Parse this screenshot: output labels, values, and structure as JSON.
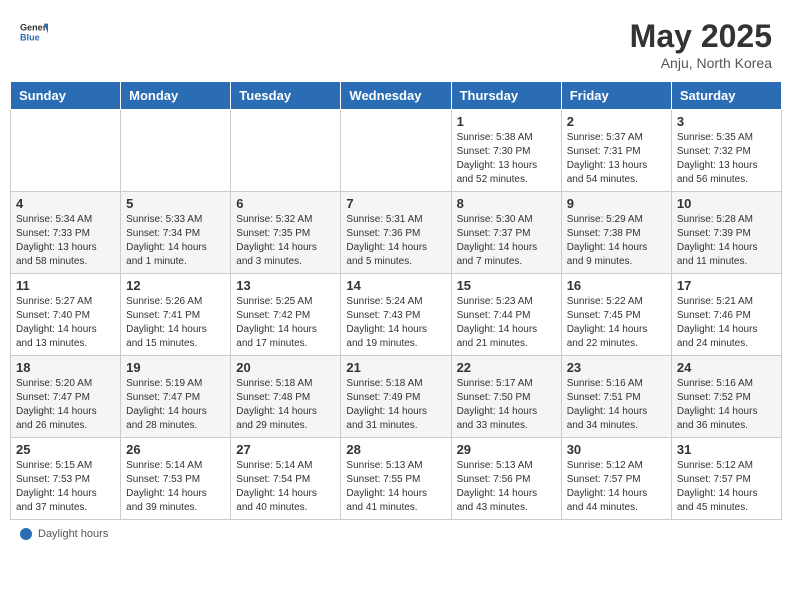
{
  "header": {
    "logo_general": "General",
    "logo_blue": "Blue",
    "month_title": "May 2025",
    "subtitle": "Anju, North Korea"
  },
  "footer": {
    "label": "Daylight hours"
  },
  "columns": [
    "Sunday",
    "Monday",
    "Tuesday",
    "Wednesday",
    "Thursday",
    "Friday",
    "Saturday"
  ],
  "weeks": [
    [
      {
        "day": "",
        "info": ""
      },
      {
        "day": "",
        "info": ""
      },
      {
        "day": "",
        "info": ""
      },
      {
        "day": "",
        "info": ""
      },
      {
        "day": "1",
        "info": "Sunrise: 5:38 AM\nSunset: 7:30 PM\nDaylight: 13 hours\nand 52 minutes."
      },
      {
        "day": "2",
        "info": "Sunrise: 5:37 AM\nSunset: 7:31 PM\nDaylight: 13 hours\nand 54 minutes."
      },
      {
        "day": "3",
        "info": "Sunrise: 5:35 AM\nSunset: 7:32 PM\nDaylight: 13 hours\nand 56 minutes."
      }
    ],
    [
      {
        "day": "4",
        "info": "Sunrise: 5:34 AM\nSunset: 7:33 PM\nDaylight: 13 hours\nand 58 minutes."
      },
      {
        "day": "5",
        "info": "Sunrise: 5:33 AM\nSunset: 7:34 PM\nDaylight: 14 hours\nand 1 minute."
      },
      {
        "day": "6",
        "info": "Sunrise: 5:32 AM\nSunset: 7:35 PM\nDaylight: 14 hours\nand 3 minutes."
      },
      {
        "day": "7",
        "info": "Sunrise: 5:31 AM\nSunset: 7:36 PM\nDaylight: 14 hours\nand 5 minutes."
      },
      {
        "day": "8",
        "info": "Sunrise: 5:30 AM\nSunset: 7:37 PM\nDaylight: 14 hours\nand 7 minutes."
      },
      {
        "day": "9",
        "info": "Sunrise: 5:29 AM\nSunset: 7:38 PM\nDaylight: 14 hours\nand 9 minutes."
      },
      {
        "day": "10",
        "info": "Sunrise: 5:28 AM\nSunset: 7:39 PM\nDaylight: 14 hours\nand 11 minutes."
      }
    ],
    [
      {
        "day": "11",
        "info": "Sunrise: 5:27 AM\nSunset: 7:40 PM\nDaylight: 14 hours\nand 13 minutes."
      },
      {
        "day": "12",
        "info": "Sunrise: 5:26 AM\nSunset: 7:41 PM\nDaylight: 14 hours\nand 15 minutes."
      },
      {
        "day": "13",
        "info": "Sunrise: 5:25 AM\nSunset: 7:42 PM\nDaylight: 14 hours\nand 17 minutes."
      },
      {
        "day": "14",
        "info": "Sunrise: 5:24 AM\nSunset: 7:43 PM\nDaylight: 14 hours\nand 19 minutes."
      },
      {
        "day": "15",
        "info": "Sunrise: 5:23 AM\nSunset: 7:44 PM\nDaylight: 14 hours\nand 21 minutes."
      },
      {
        "day": "16",
        "info": "Sunrise: 5:22 AM\nSunset: 7:45 PM\nDaylight: 14 hours\nand 22 minutes."
      },
      {
        "day": "17",
        "info": "Sunrise: 5:21 AM\nSunset: 7:46 PM\nDaylight: 14 hours\nand 24 minutes."
      }
    ],
    [
      {
        "day": "18",
        "info": "Sunrise: 5:20 AM\nSunset: 7:47 PM\nDaylight: 14 hours\nand 26 minutes."
      },
      {
        "day": "19",
        "info": "Sunrise: 5:19 AM\nSunset: 7:47 PM\nDaylight: 14 hours\nand 28 minutes."
      },
      {
        "day": "20",
        "info": "Sunrise: 5:18 AM\nSunset: 7:48 PM\nDaylight: 14 hours\nand 29 minutes."
      },
      {
        "day": "21",
        "info": "Sunrise: 5:18 AM\nSunset: 7:49 PM\nDaylight: 14 hours\nand 31 minutes."
      },
      {
        "day": "22",
        "info": "Sunrise: 5:17 AM\nSunset: 7:50 PM\nDaylight: 14 hours\nand 33 minutes."
      },
      {
        "day": "23",
        "info": "Sunrise: 5:16 AM\nSunset: 7:51 PM\nDaylight: 14 hours\nand 34 minutes."
      },
      {
        "day": "24",
        "info": "Sunrise: 5:16 AM\nSunset: 7:52 PM\nDaylight: 14 hours\nand 36 minutes."
      }
    ],
    [
      {
        "day": "25",
        "info": "Sunrise: 5:15 AM\nSunset: 7:53 PM\nDaylight: 14 hours\nand 37 minutes."
      },
      {
        "day": "26",
        "info": "Sunrise: 5:14 AM\nSunset: 7:53 PM\nDaylight: 14 hours\nand 39 minutes."
      },
      {
        "day": "27",
        "info": "Sunrise: 5:14 AM\nSunset: 7:54 PM\nDaylight: 14 hours\nand 40 minutes."
      },
      {
        "day": "28",
        "info": "Sunrise: 5:13 AM\nSunset: 7:55 PM\nDaylight: 14 hours\nand 41 minutes."
      },
      {
        "day": "29",
        "info": "Sunrise: 5:13 AM\nSunset: 7:56 PM\nDaylight: 14 hours\nand 43 minutes."
      },
      {
        "day": "30",
        "info": "Sunrise: 5:12 AM\nSunset: 7:57 PM\nDaylight: 14 hours\nand 44 minutes."
      },
      {
        "day": "31",
        "info": "Sunrise: 5:12 AM\nSunset: 7:57 PM\nDaylight: 14 hours\nand 45 minutes."
      }
    ]
  ]
}
